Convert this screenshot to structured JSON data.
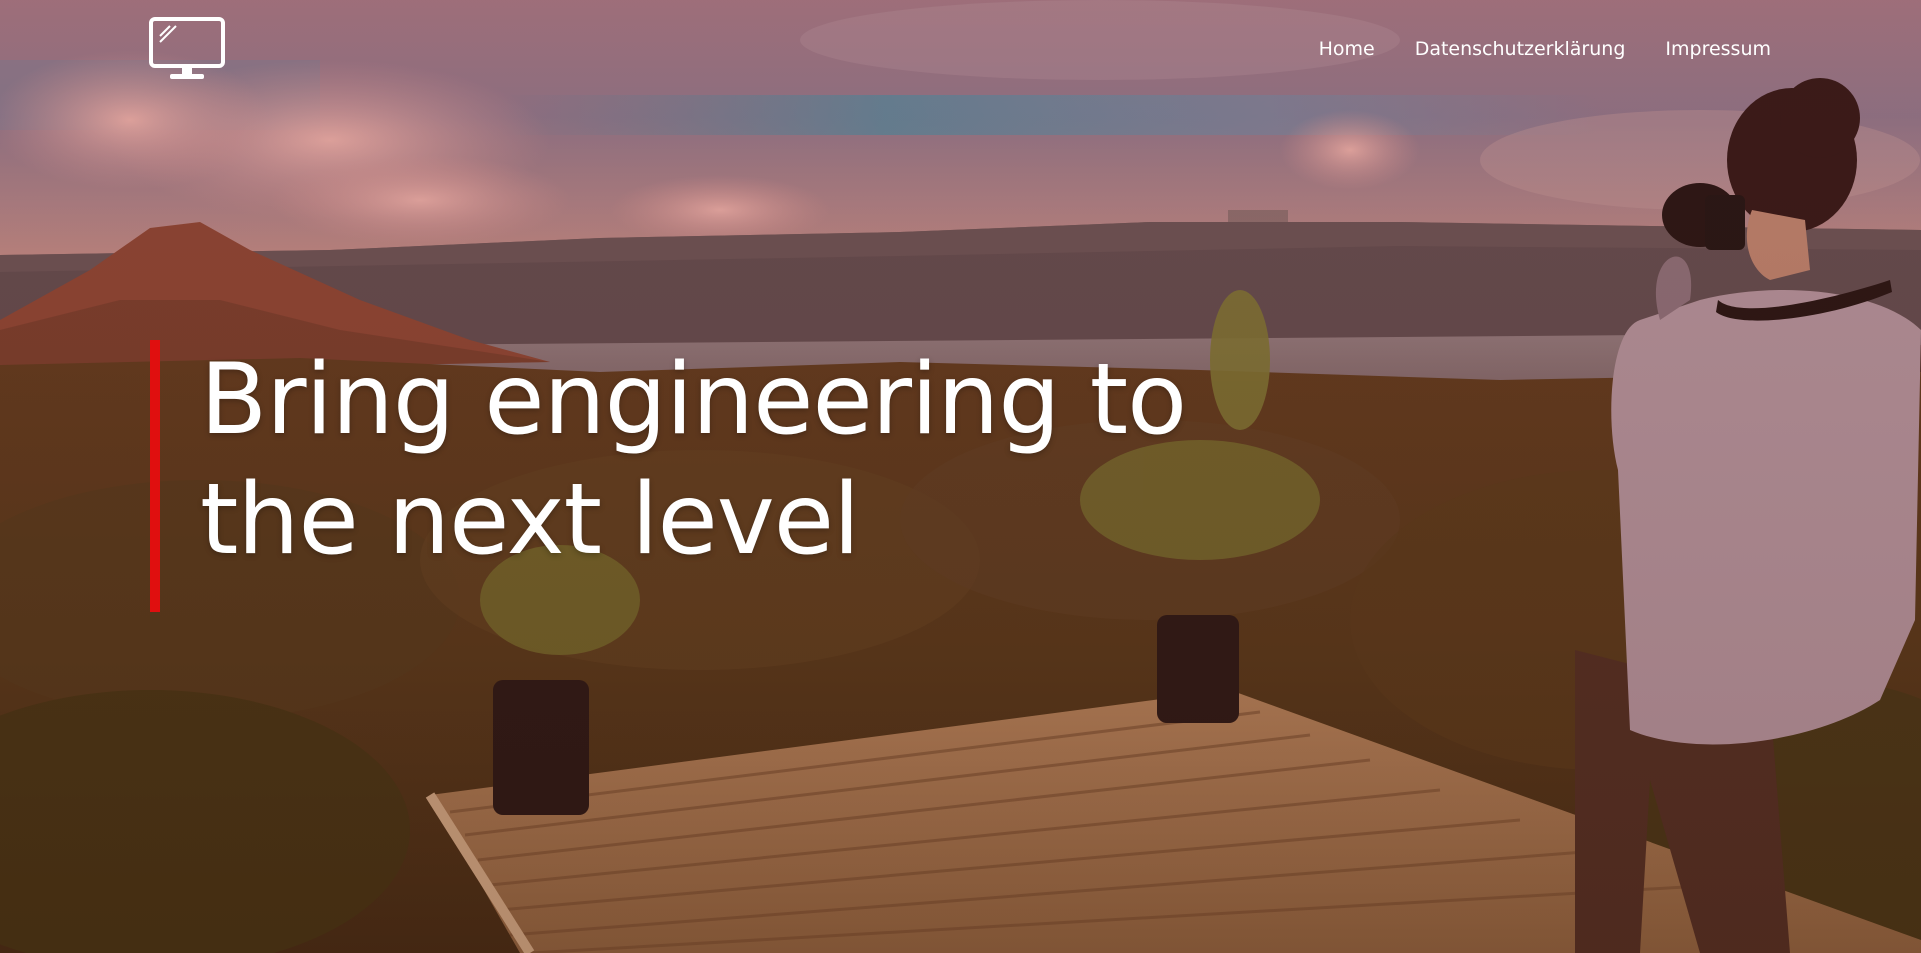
{
  "header": {
    "logo_icon": "monitor-icon",
    "nav": [
      {
        "label": "Home"
      },
      {
        "label": "Datenschutzerklärung"
      },
      {
        "label": "Impressum"
      }
    ]
  },
  "hero": {
    "headline_line1": "Bring engineering to",
    "headline_line2": "the next level",
    "accent_color": "#e00f0f",
    "overlay_tint": "#8a3a2e"
  }
}
